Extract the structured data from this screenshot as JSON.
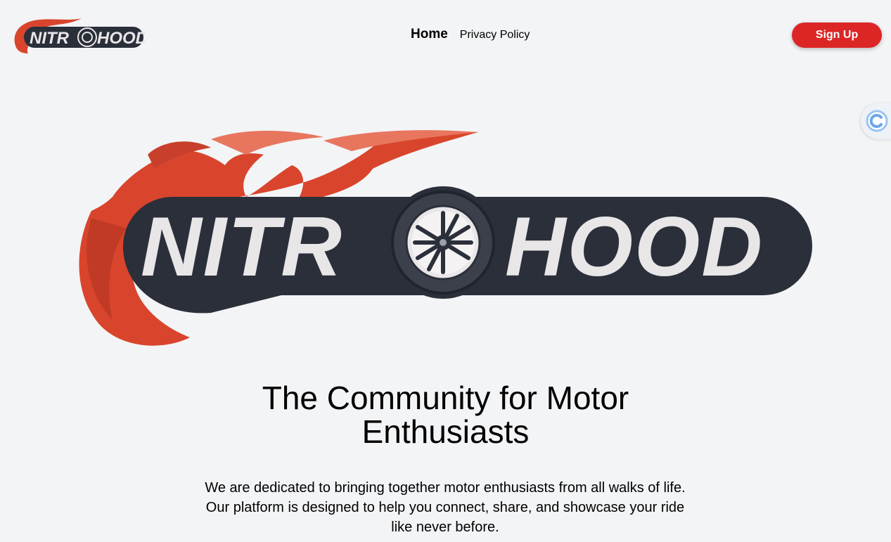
{
  "brand": {
    "name_part1": "NITR",
    "name_part2": "HOOD",
    "colors": {
      "flame": "#d9452c",
      "flame_light": "#e8765f",
      "dark": "#2a2f3a",
      "letters": "#e9e6e8",
      "accent": "#dc2626"
    }
  },
  "nav": {
    "home_label": "Home",
    "privacy_label": "Privacy Policy"
  },
  "header": {
    "signup_label": "Sign Up"
  },
  "side_widget": {
    "icon": "c-circle-icon"
  },
  "hero": {
    "headline": "The Community for Motor Enthusiasts",
    "description": "We are dedicated to bringing together motor enthusiasts from all walks of life. Our platform is designed to help you connect, share, and showcase your ride like never before."
  }
}
